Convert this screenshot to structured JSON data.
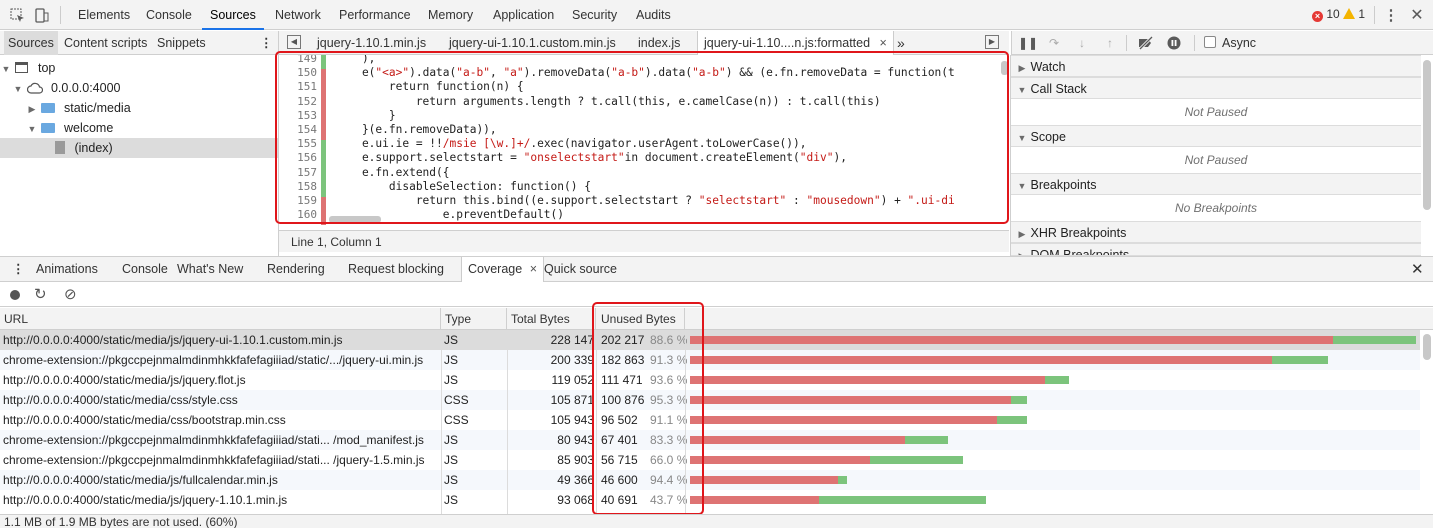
{
  "toolbar": {
    "tabs": [
      "Elements",
      "Console",
      "Sources",
      "Network",
      "Performance",
      "Memory",
      "Application",
      "Security",
      "Audits"
    ],
    "errors": "10",
    "warnings": "1"
  },
  "navigator": {
    "tabs": [
      "Sources",
      "Content scripts",
      "Snippets"
    ],
    "tree": [
      "top",
      "0.0.0.0:4000",
      "static/media",
      "welcome",
      "(index)"
    ]
  },
  "editor": {
    "tabs": [
      "jquery-1.10.1.min.js",
      "jquery-ui-1.10.1.custom.min.js",
      "index.js",
      "jquery-ui-1.10....n.js:formatted"
    ],
    "line_numbers": [
      "149",
      "150",
      "151",
      "152",
      "153",
      "154",
      "155",
      "156",
      "157",
      "158",
      "159",
      "160"
    ],
    "status": "Line 1, Column 1"
  },
  "debugger": {
    "async_label": "Async",
    "sections": [
      "Watch",
      "Call Stack",
      "Scope",
      "Breakpoints",
      "XHR Breakpoints",
      "DOM Breakpoints"
    ],
    "not_paused": "Not Paused",
    "no_breakpoints": "No Breakpoints"
  },
  "drawer": {
    "tabs": [
      "Animations",
      "Console",
      "What's New",
      "Rendering",
      "Request blocking",
      "Coverage",
      "Quick source"
    ]
  },
  "coverage": {
    "columns": [
      "URL",
      "Type",
      "Total Bytes",
      "Unused Bytes"
    ],
    "rows": [
      {
        "url": "http://0.0.0.0:4000/static/media/js/jquery-ui-1.10.1.custom.min.js",
        "type": "JS",
        "total": "228 147",
        "unused": "202 217",
        "pct": "88.6 %",
        "used_frac": 0.114
      },
      {
        "url": "chrome-extension://pkgccpejnmalmdinmhkkfafefagiiiad/static/.../jquery-ui.min.js",
        "type": "JS",
        "total": "200 339",
        "unused": "182 863",
        "pct": "91.3 %",
        "used_frac": 0.087
      },
      {
        "url": "http://0.0.0.0:4000/static/media/js/jquery.flot.js",
        "type": "JS",
        "total": "119 052",
        "unused": "111 471",
        "pct": "93.6 %",
        "used_frac": 0.064
      },
      {
        "url": "http://0.0.0.0:4000/static/media/css/style.css",
        "type": "CSS",
        "total": "105 871",
        "unused": "100 876",
        "pct": "95.3 %",
        "used_frac": 0.047
      },
      {
        "url": "http://0.0.0.0:4000/static/media/css/bootstrap.min.css",
        "type": "CSS",
        "total": "105 943",
        "unused": "96 502",
        "pct": "91.1 %",
        "used_frac": 0.089
      },
      {
        "url": "chrome-extension://pkgccpejnmalmdinmhkkfafefagiiiad/stati... /mod_manifest.js",
        "type": "JS",
        "total": "80 943",
        "unused": "67 401",
        "pct": "83.3 %",
        "used_frac": 0.167
      },
      {
        "url": "chrome-extension://pkgccpejnmalmdinmhkkfafefagiiiad/stati... /jquery-1.5.min.js",
        "type": "JS",
        "total": "85 903",
        "unused": "56 715",
        "pct": "66.0 %",
        "used_frac": 0.34
      },
      {
        "url": "http://0.0.0.0:4000/static/media/js/fullcalendar.min.js",
        "type": "JS",
        "total": "49 366",
        "unused": "46 600",
        "pct": "94.4 %",
        "used_frac": 0.056
      },
      {
        "url": "http://0.0.0.0:4000/static/media/js/jquery-1.10.1.min.js",
        "type": "JS",
        "total": "93 068",
        "unused": "40 691",
        "pct": "43.7 %",
        "used_frac": 0.563
      }
    ],
    "footer": "1.1 MB of 1.9 MB bytes are not used. (60%)"
  },
  "colors": {
    "accent": "#1a73e8",
    "unused": "#de7373",
    "used": "#7cc47c",
    "highlight_box": "#e0161b"
  }
}
